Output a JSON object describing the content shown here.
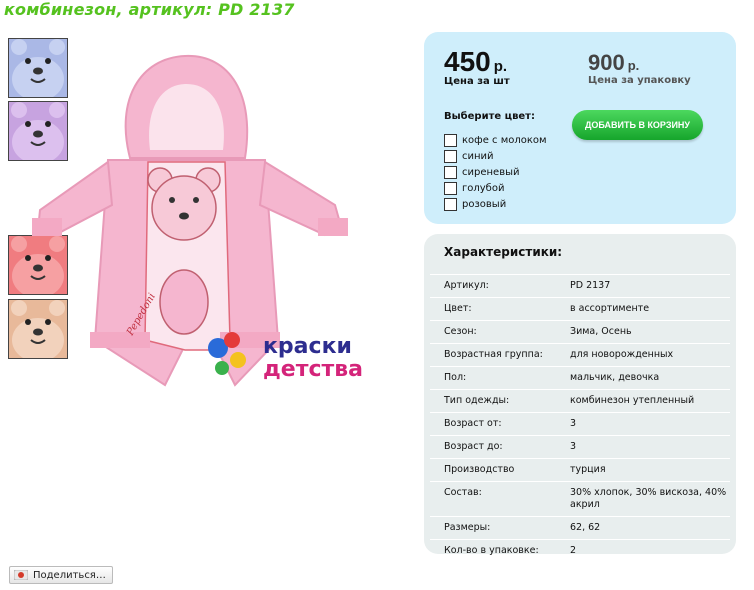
{
  "page_title": "комбинезон, артикул: PD 2137",
  "brand_logo": {
    "line1": "краски",
    "line2": "детства"
  },
  "product_label": "Pepedoni",
  "thumbnails": [
    {
      "color": "#aab8e6",
      "icon": "bear-face-thumb-blue"
    },
    {
      "color": "#c7a3e0",
      "icon": "bear-face-thumb-lilac"
    },
    {
      "color": "#f07c80",
      "icon": "bear-face-thumb-coral"
    },
    {
      "color": "#e8b99a",
      "icon": "bear-face-thumb-beige"
    }
  ],
  "price": {
    "main_value": "450",
    "main_currency": "р.",
    "main_caption": "Цена за шт",
    "pack_value": "900",
    "pack_currency": "р.",
    "pack_caption": "Цена за упаковку"
  },
  "color_select": {
    "label": "Выберите цвет:",
    "options": [
      "кофе с молоком",
      "синий",
      "сиреневый",
      "голубой",
      "розовый"
    ]
  },
  "add_to_cart": "ДОБАВИТЬ В КОРЗИНУ",
  "specs": {
    "title": "Характеристики:",
    "rows": [
      {
        "key": "Артикул:",
        "value": "PD 2137"
      },
      {
        "key": "Цвет:",
        "value": "в ассортименте"
      },
      {
        "key": "Сезон:",
        "value": "Зима, Осень"
      },
      {
        "key": "Возрастная группа:",
        "value": "для новорожденных"
      },
      {
        "key": "Пол:",
        "value": "мальчик, девочка"
      },
      {
        "key": "Тип одежды:",
        "value": "комбинезон утепленный"
      },
      {
        "key": "Возраст от:",
        "value": "3"
      },
      {
        "key": "Возраст до:",
        "value": "3"
      },
      {
        "key": "Производство",
        "value": "турция"
      },
      {
        "key": "Состав:",
        "value": "30% хлопок, 30% вискоза, 40% акрил"
      },
      {
        "key": "Размеры:",
        "value": "62, 62"
      },
      {
        "key": "Кол-во в упаковке:",
        "value": "2"
      }
    ]
  },
  "share_button": "Поделиться…",
  "colors": {
    "accent_green": "#55c21f",
    "price_box": "#cfeefb",
    "specs_box": "#e8eeee",
    "garment_pink": "#f5b6cf"
  }
}
